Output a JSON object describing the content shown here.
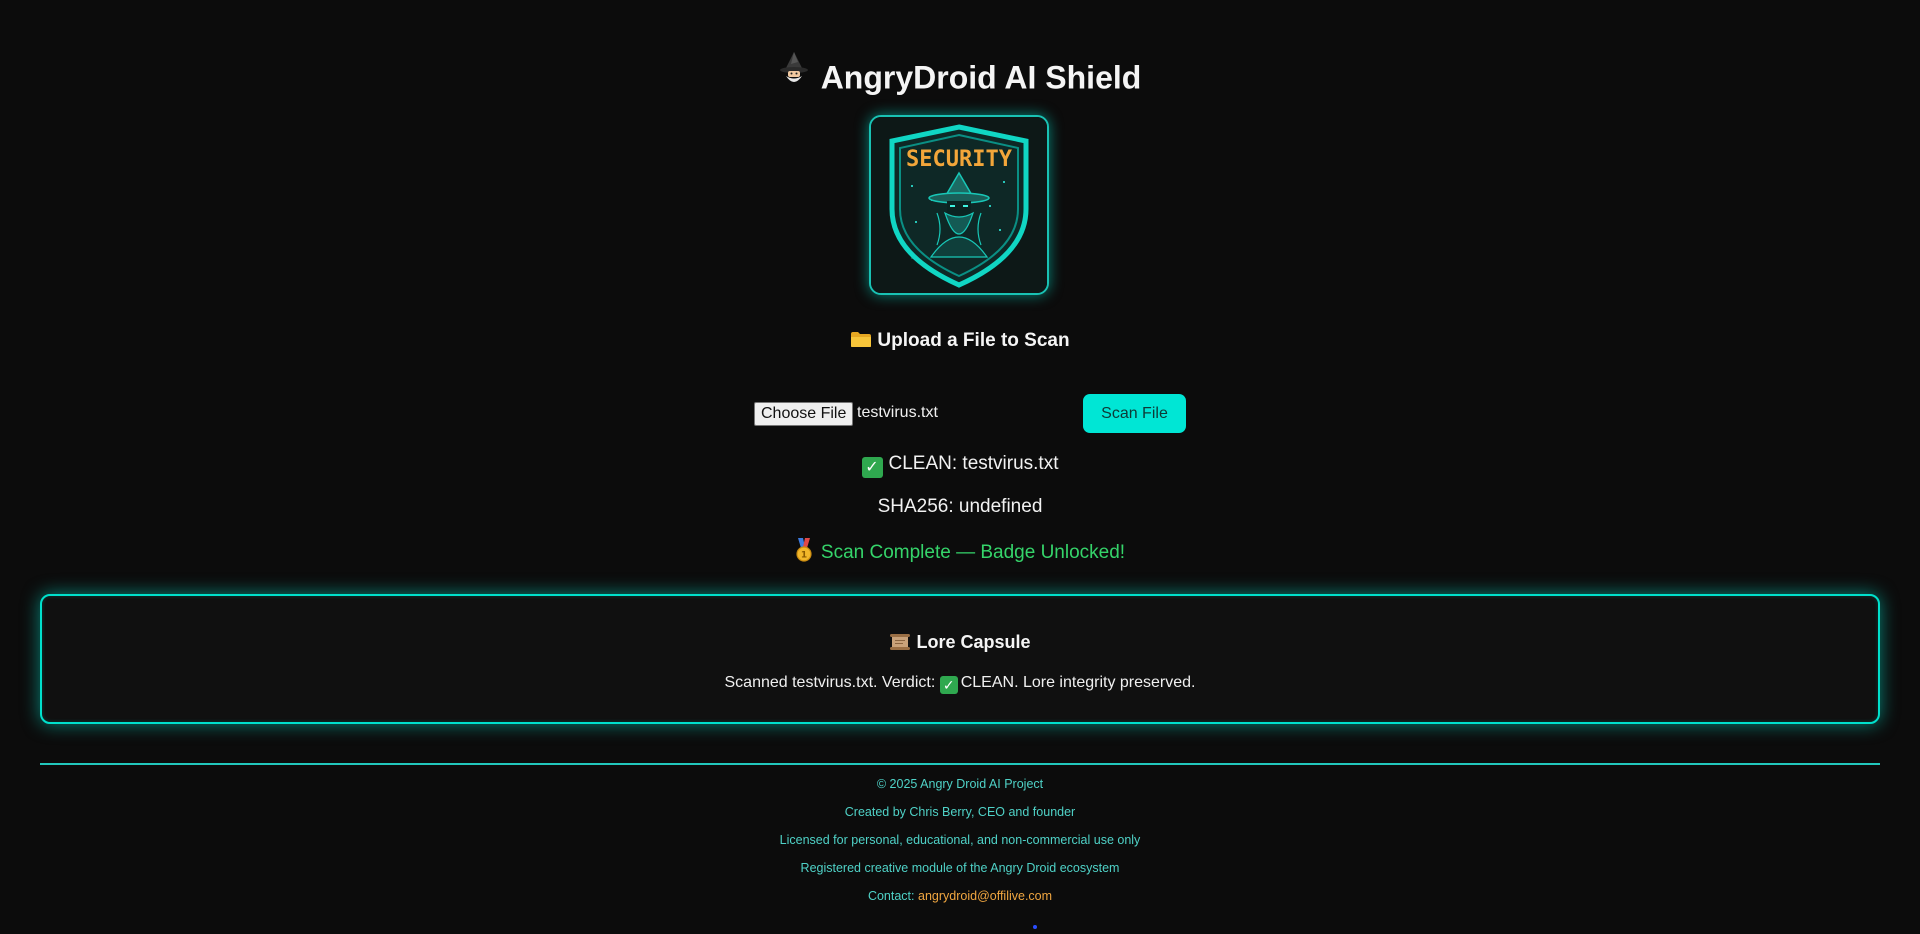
{
  "header": {
    "title": "AngryDroid AI Shield",
    "icon": "wizard-icon"
  },
  "shield": {
    "label": "SECURITY",
    "icon": "shield-wizard-logo",
    "label_color": "#f2a63a",
    "glow_color": "#19c2b4"
  },
  "upload": {
    "heading": "Upload a File to Scan",
    "heading_icon": "folder-icon",
    "choose_label": "Choose File",
    "file_name": "testvirus.txt",
    "scan_label": "Scan File",
    "scan_color": "#00e6d5"
  },
  "result": {
    "status": "CLEAN: testvirus.txt",
    "status_icon": "check-icon",
    "sha": "SHA256: undefined",
    "badge": "Scan Complete — Badge Unlocked!",
    "badge_icon": "medal-icon",
    "badge_color": "#35d46a"
  },
  "lore": {
    "title": "Lore Capsule",
    "title_icon": "scroll-icon",
    "text_prefix": "Scanned testvirus.txt. Verdict:",
    "text_suffix": "CLEAN. Lore integrity preserved."
  },
  "footer": {
    "copyright": "© 2025 Angry Droid AI Project",
    "created": "Created by Chris Berry, CEO and founder",
    "license": "Licensed for personal, educational, and non-commercial use only",
    "registered": "Registered creative module of the Angry Droid ecosystem",
    "contact_label": "Contact:",
    "contact_email": "angrydroid@offilive.com",
    "text_color": "#4fd2c7",
    "email_color": "#f0a640"
  }
}
